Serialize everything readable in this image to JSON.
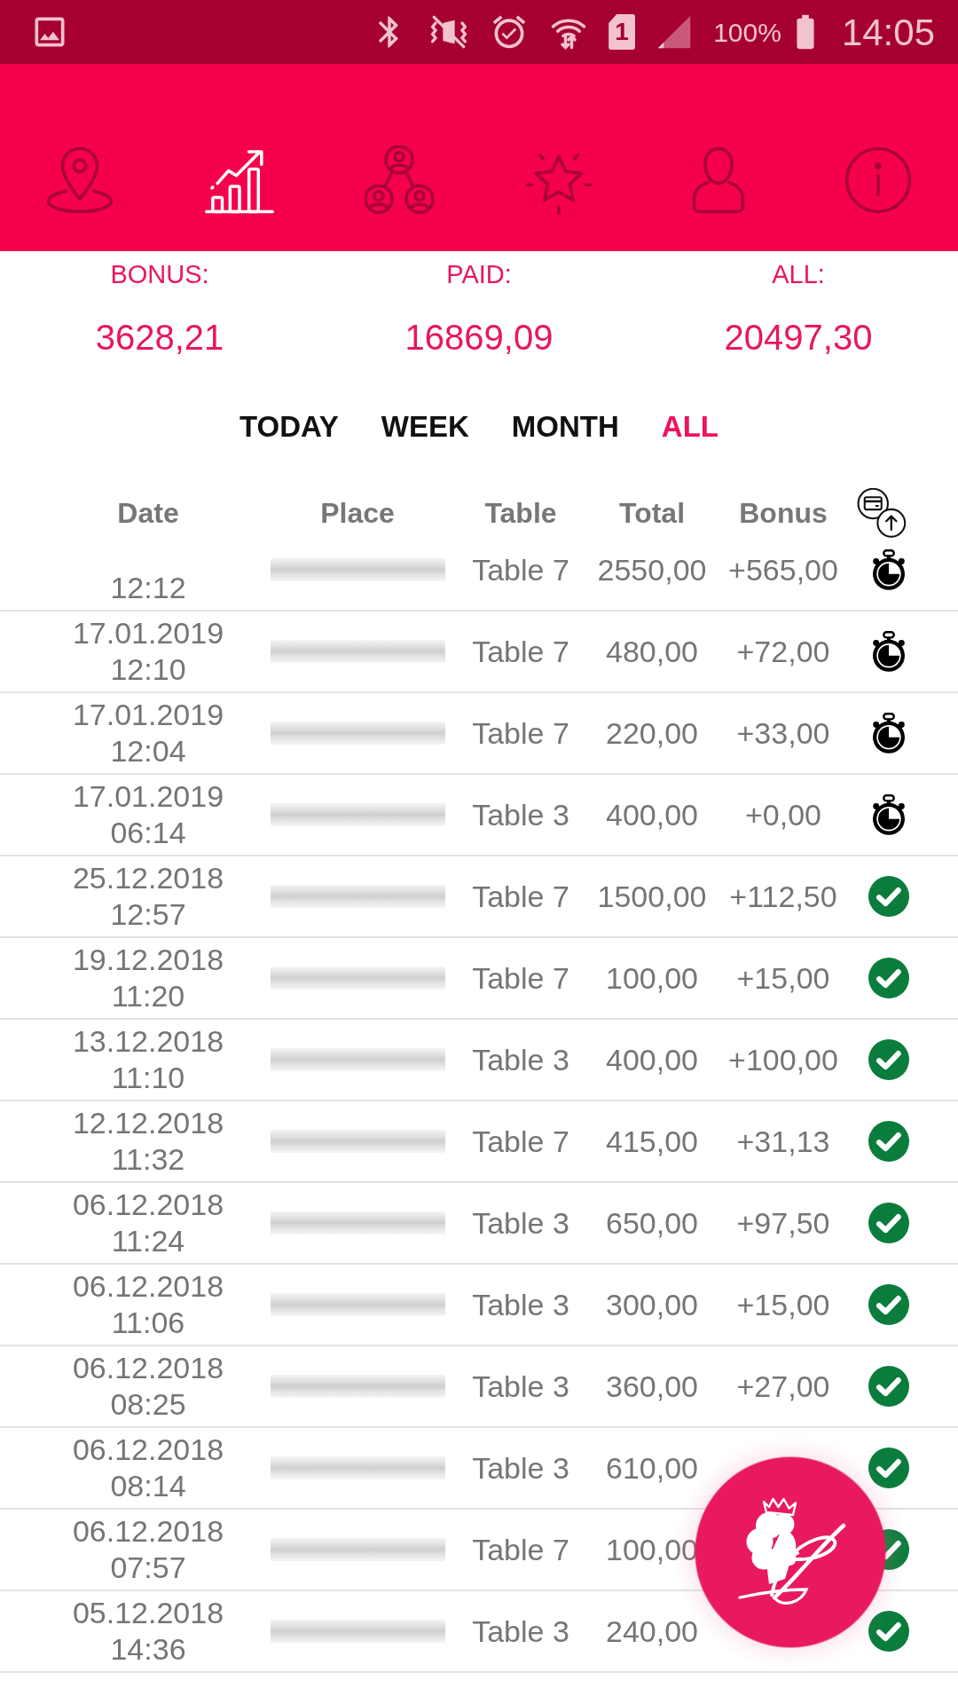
{
  "status_bar": {
    "sim": "1",
    "battery": "100%",
    "time": "14:05"
  },
  "nav_tabs": [
    {
      "selected": false
    },
    {
      "selected": true
    },
    {
      "selected": false
    },
    {
      "selected": false
    },
    {
      "selected": false
    },
    {
      "selected": false
    }
  ],
  "summary": [
    {
      "label": "BONUS:",
      "value": "3628,21"
    },
    {
      "label": "PAID:",
      "value": "16869,09"
    },
    {
      "label": "ALL:",
      "value": "20497,30"
    }
  ],
  "period_tabs": [
    {
      "label": "TODAY",
      "selected": false
    },
    {
      "label": "WEEK",
      "selected": false
    },
    {
      "label": "MONTH",
      "selected": false
    },
    {
      "label": "ALL",
      "selected": true
    }
  ],
  "table": {
    "columns": [
      "Date",
      "Place",
      "Table",
      "Total",
      "Bonus"
    ],
    "rows": [
      {
        "time": "12:12",
        "table": "Table 7",
        "total": "2550,00",
        "bonus": "+565,00",
        "confirmed": false
      },
      {
        "date": "17.01.2019",
        "time": "12:10",
        "table": "Table 7",
        "total": "480,00",
        "bonus": "+72,00",
        "confirmed": false
      },
      {
        "date": "17.01.2019",
        "time": "12:04",
        "table": "Table 7",
        "total": "220,00",
        "bonus": "+33,00",
        "confirmed": false
      },
      {
        "date": "17.01.2019",
        "time": "06:14",
        "table": "Table 3",
        "total": "400,00",
        "bonus": "+0,00",
        "confirmed": false
      },
      {
        "date": "25.12.2018",
        "time": "12:57",
        "table": "Table 7",
        "total": "1500,00",
        "bonus": "+112,50",
        "confirmed": true
      },
      {
        "date": "19.12.2018",
        "time": "11:20",
        "table": "Table 7",
        "total": "100,00",
        "bonus": "+15,00",
        "confirmed": true
      },
      {
        "date": "13.12.2018",
        "time": "11:10",
        "table": "Table 3",
        "total": "400,00",
        "bonus": "+100,00",
        "confirmed": true
      },
      {
        "date": "12.12.2018",
        "time": "11:32",
        "table": "Table 7",
        "total": "415,00",
        "bonus": "+31,13",
        "confirmed": true
      },
      {
        "date": "06.12.2018",
        "time": "11:24",
        "table": "Table 3",
        "total": "650,00",
        "bonus": "+97,50",
        "confirmed": true
      },
      {
        "date": "06.12.2018",
        "time": "11:06",
        "table": "Table 3",
        "total": "300,00",
        "bonus": "+15,00",
        "confirmed": true
      },
      {
        "date": "06.12.2018",
        "time": "08:25",
        "table": "Table 3",
        "total": "360,00",
        "bonus": "+27,00",
        "confirmed": true
      },
      {
        "date": "06.12.2018",
        "time": "08:14",
        "table": "Table 3",
        "total": "610,00",
        "confirmed": true
      },
      {
        "date": "06.12.2018",
        "time": "07:57",
        "table": "Table 7",
        "total": "100,00",
        "confirmed": true
      },
      {
        "date": "05.12.2018",
        "time": "14:36",
        "table": "Table 3",
        "total": "240,00",
        "confirmed": true
      }
    ]
  }
}
